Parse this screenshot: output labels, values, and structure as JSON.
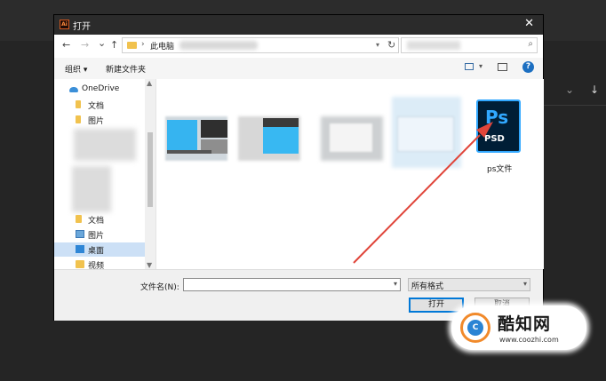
{
  "dialog": {
    "title": "打开",
    "app_icon_text": "Ai",
    "close_glyph": "✕"
  },
  "nav": {
    "back": "←",
    "forward": "→",
    "recent": "⌄",
    "up": "↑"
  },
  "address": {
    "separator": "›",
    "location": "此电脑",
    "dropdown": "▾",
    "refresh": "↻"
  },
  "search": {
    "icon": "⌕"
  },
  "toolbar": {
    "organize": "组织 ▾",
    "new_folder": "新建文件夹",
    "view_dropdown": "▾",
    "help": "?"
  },
  "sidebar": {
    "items": [
      {
        "label": "OneDrive",
        "icon": "cloud-icon"
      },
      {
        "label": "文档",
        "icon": "folder-icon"
      },
      {
        "label": "图片",
        "icon": "folder-icon"
      },
      {
        "label": "文档",
        "icon": "folder-icon"
      },
      {
        "label": "图片",
        "icon": "picture-icon"
      },
      {
        "label": "桌面",
        "icon": "desktop-icon"
      },
      {
        "label": "视频",
        "icon": "folder-icon"
      }
    ],
    "scroll_up": "▲",
    "scroll_down": "▼"
  },
  "files": {
    "psd": {
      "label": "ps文件",
      "icon_text": "Ps",
      "tag": "PSD"
    }
  },
  "bottom": {
    "filename_label": "文件名(N):",
    "filename_value": "",
    "filter_value": "所有格式",
    "dropdown": "▾",
    "open_button": "打开",
    "cancel_button": "取消"
  },
  "background_app": {
    "chevron": "⌄",
    "download": "↓"
  },
  "watermark": {
    "brand": "酷知网",
    "url": "www.coozhi.com",
    "logo_text": "C"
  },
  "colors": {
    "ps_blue": "#31a8ff",
    "ps_dark": "#001e36",
    "arrow_red": "#e0453a",
    "accent_blue": "#0078d7"
  }
}
